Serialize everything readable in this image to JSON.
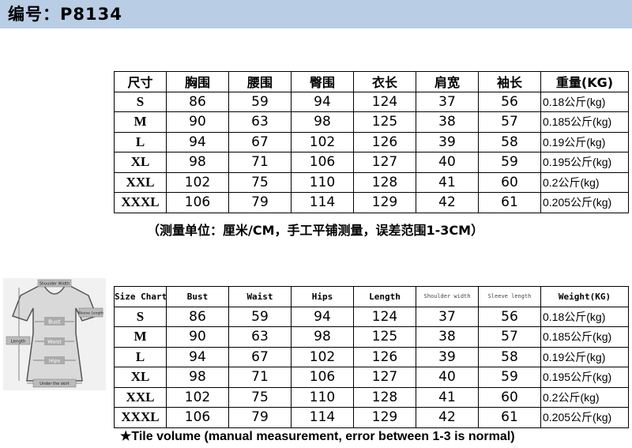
{
  "header": {
    "title": "编号：P8134"
  },
  "table_cn": {
    "headers": [
      "尺寸",
      "胸围",
      "腰围",
      "臀围",
      "衣长",
      "肩宽",
      "袖长",
      "重量(KG)"
    ],
    "rows": [
      [
        "S",
        "86",
        "59",
        "94",
        "124",
        "37",
        "56",
        "0.18公斤(kg)"
      ],
      [
        "M",
        "90",
        "63",
        "98",
        "125",
        "38",
        "57",
        "0.185公斤(kg)"
      ],
      [
        "L",
        "94",
        "67",
        "102",
        "126",
        "39",
        "58",
        "0.19公斤(kg)"
      ],
      [
        "XL",
        "98",
        "71",
        "106",
        "127",
        "40",
        "59",
        "0.195公斤(kg)"
      ],
      [
        "XXL",
        "102",
        "75",
        "110",
        "128",
        "41",
        "60",
        "0.2公斤(kg)"
      ],
      [
        "XXXL",
        "106",
        "79",
        "114",
        "129",
        "42",
        "61",
        "0.205公斤(kg)"
      ]
    ]
  },
  "note_cn": "（测量单位：厘米/CM，手工平铺测量，误差范围1-3CM）",
  "diagram": {
    "labels": {
      "shoulder": "Shoulder Width",
      "sleeve": "Sleeve Length",
      "bust": "Bust",
      "waist": "Waist",
      "hips": "Hips",
      "length": "Length",
      "hem": "Under the skirt"
    }
  },
  "table_en": {
    "headers": [
      "Size Chart",
      "Bust",
      "Waist",
      "Hips",
      "Length",
      "Shoulder width",
      "Sleeve length",
      "Weight(KG)"
    ],
    "rows": [
      [
        "S",
        "86",
        "59",
        "94",
        "124",
        "37",
        "56",
        "0.18公斤(kg)"
      ],
      [
        "M",
        "90",
        "63",
        "98",
        "125",
        "38",
        "57",
        "0.185公斤(kg)"
      ],
      [
        "L",
        "94",
        "67",
        "102",
        "126",
        "39",
        "58",
        "0.19公斤(kg)"
      ],
      [
        "XL",
        "98",
        "71",
        "106",
        "127",
        "40",
        "59",
        "0.195公斤(kg)"
      ],
      [
        "XXL",
        "102",
        "75",
        "110",
        "128",
        "41",
        "60",
        "0.2公斤(kg)"
      ],
      [
        "XXXL",
        "106",
        "79",
        "114",
        "129",
        "42",
        "61",
        "0.205公斤(kg)"
      ]
    ]
  },
  "note_en": "★Tile volume (manual measurement, error between 1-3 is normal)"
}
